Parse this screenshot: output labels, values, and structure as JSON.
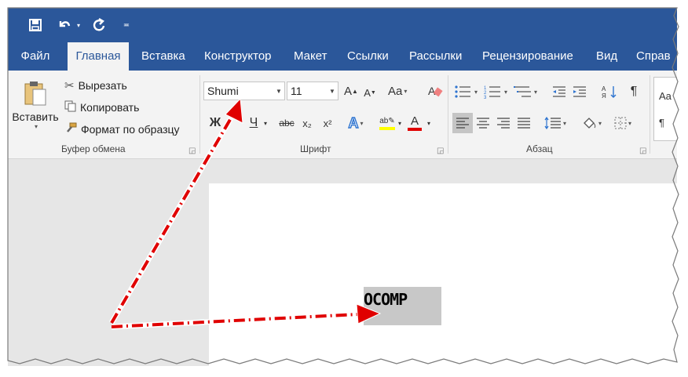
{
  "quick_access": {
    "save_icon": "save-icon",
    "undo_icon": "undo-icon",
    "redo_icon": "redo-icon",
    "customize_icon": "customize-icon"
  },
  "tabs": [
    {
      "label": "Файл"
    },
    {
      "label": "Главная",
      "active": true
    },
    {
      "label": "Вставка"
    },
    {
      "label": "Конструктор"
    },
    {
      "label": "Макет"
    },
    {
      "label": "Ссылки"
    },
    {
      "label": "Рассылки"
    },
    {
      "label": "Рецензирование"
    },
    {
      "label": "Вид"
    },
    {
      "label": "Справ"
    }
  ],
  "clipboard": {
    "paste_label": "Вставить",
    "cut_label": "Вырезать",
    "copy_label": "Копировать",
    "format_painter_label": "Формат по образцу",
    "group_label": "Буфер обмена"
  },
  "font": {
    "font_name": "Shumi",
    "font_size": "11",
    "group_label": "Шрифт",
    "change_case_label": "Aa",
    "bold_label": "Ж",
    "underline_label": "Ч",
    "strike_label": "abc",
    "subscript_label": "x₂",
    "superscript_label": "x²",
    "text_effects_label": "A",
    "font_color_label": "A",
    "highlight_color": "#ffff00",
    "font_color": "#e00000"
  },
  "paragraph": {
    "group_label": "Абзац",
    "pilcrow": "¶"
  },
  "styles": {
    "preview_label": "Aa"
  },
  "document": {
    "sample_text": "OCOMP"
  },
  "colors": {
    "ribbon_blue": "#2b579a",
    "arrow_red": "#e00000"
  }
}
